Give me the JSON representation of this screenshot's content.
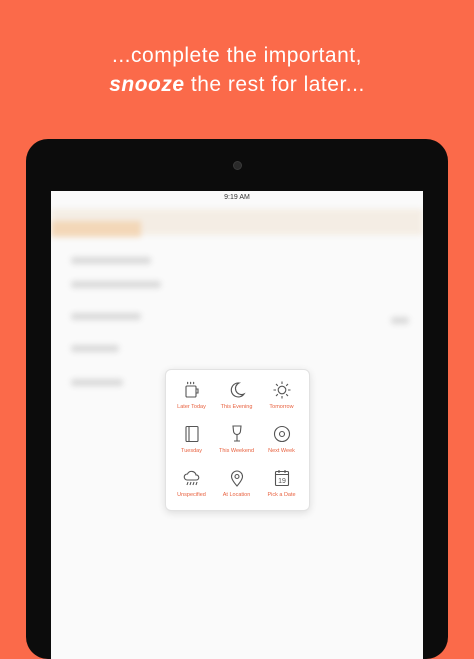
{
  "headline": {
    "line1": "...complete the important,",
    "line2_bold": "snooze",
    "line2_rest": " the rest for later..."
  },
  "status": {
    "time": "9:19 AM"
  },
  "snooze_options": [
    {
      "label": "Later Today",
      "icon": "coffee-cup-icon"
    },
    {
      "label": "This Evening",
      "icon": "moon-icon"
    },
    {
      "label": "Tomorrow",
      "icon": "sun-icon"
    },
    {
      "label": "Tuesday",
      "icon": "notebook-icon"
    },
    {
      "label": "This Weekend",
      "icon": "wine-glass-icon"
    },
    {
      "label": "Next Week",
      "icon": "record-icon"
    },
    {
      "label": "Unspecified",
      "icon": "rain-cloud-icon"
    },
    {
      "label": "At Location",
      "icon": "location-pin-icon"
    },
    {
      "label": "Pick a Date",
      "icon": "calendar-icon",
      "day": "19"
    }
  ],
  "colors": {
    "background": "#fb6a4a",
    "accent": "#e8613f",
    "icon_stroke": "#555555"
  }
}
